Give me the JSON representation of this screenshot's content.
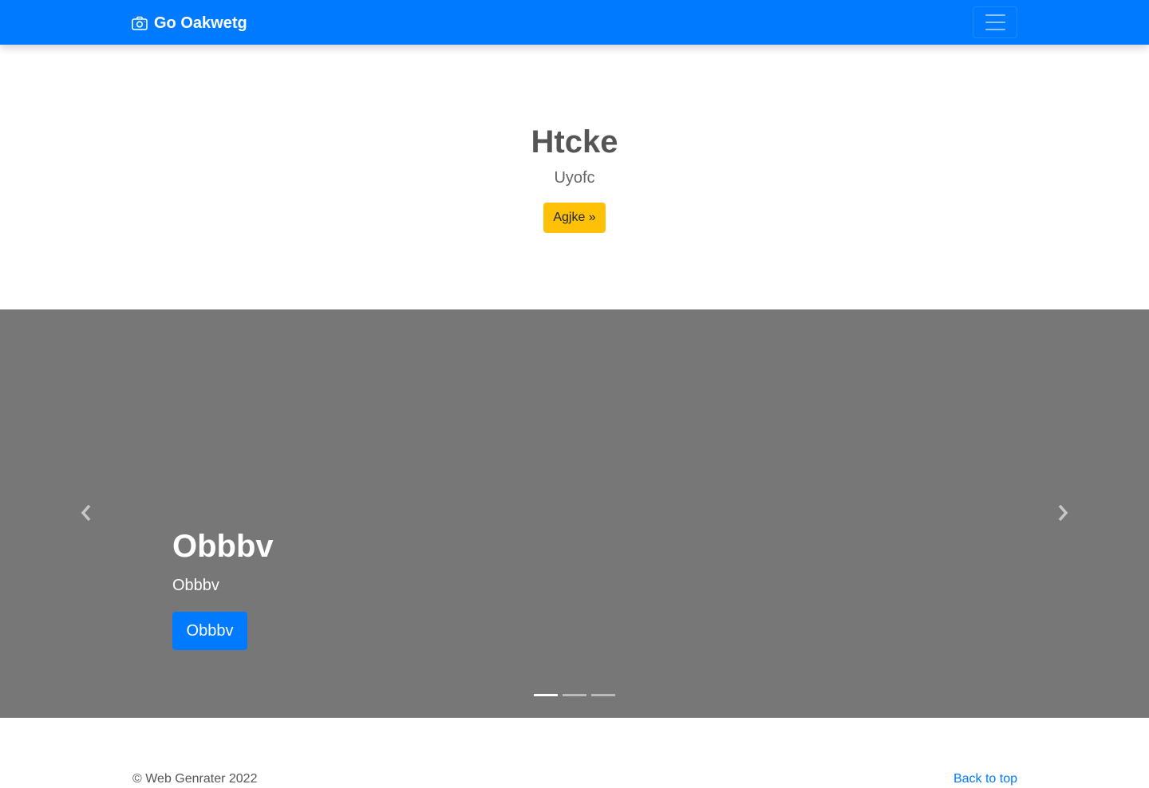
{
  "navbar": {
    "brand_icon": "camera-icon",
    "brand_text": "Go Oakwetg",
    "toggler_icon": "hamburger-menu-icon",
    "color": "#007bff"
  },
  "hero": {
    "title": "Htcke",
    "subtitle": "Uyofc",
    "button_label": "Agjke »",
    "button_color": "#ffc107"
  },
  "carousel": {
    "background": "#777777",
    "prev_icon": "chevron-left-icon",
    "next_icon": "chevron-right-icon",
    "slide": {
      "heading": "Obbbv",
      "text": "Obbbv",
      "button_label": "Obbbv"
    },
    "indicator_count": 3,
    "active_indicator": 1
  },
  "footer": {
    "copyright": "© Web Genrater 2022",
    "back_to_top": "Back to top"
  }
}
